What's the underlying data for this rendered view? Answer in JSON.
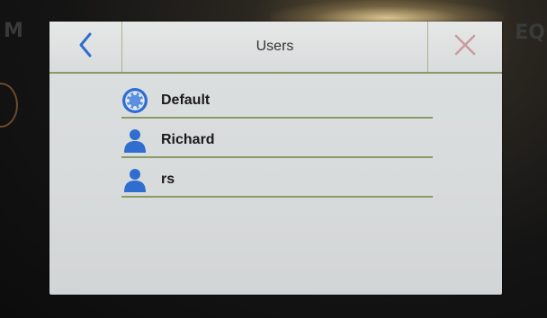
{
  "header": {
    "title": "Users",
    "back_icon": "chevron-left-icon",
    "close_icon": "close-icon"
  },
  "bezel": {
    "left_text": "M",
    "right_text": "EQ"
  },
  "users": [
    {
      "label": "Default",
      "icon": "default-user-icon"
    },
    {
      "label": "Richard",
      "icon": "person-icon"
    },
    {
      "label": "rs",
      "icon": "person-icon"
    }
  ],
  "colors": {
    "accent": "#2f6ecf",
    "divider": "#8a9a66",
    "close": "#c99aa0"
  }
}
